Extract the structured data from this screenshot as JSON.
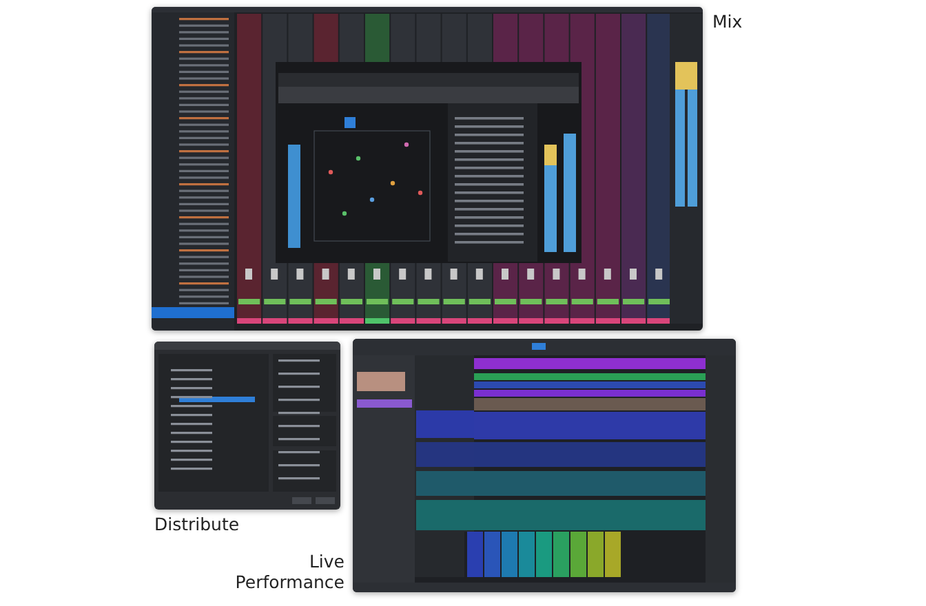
{
  "panels": [
    {
      "kind": "mix",
      "caption": "Mix"
    },
    {
      "kind": "distribute",
      "caption": "Distribute"
    },
    {
      "kind": "live",
      "caption": "Live Performance"
    }
  ]
}
